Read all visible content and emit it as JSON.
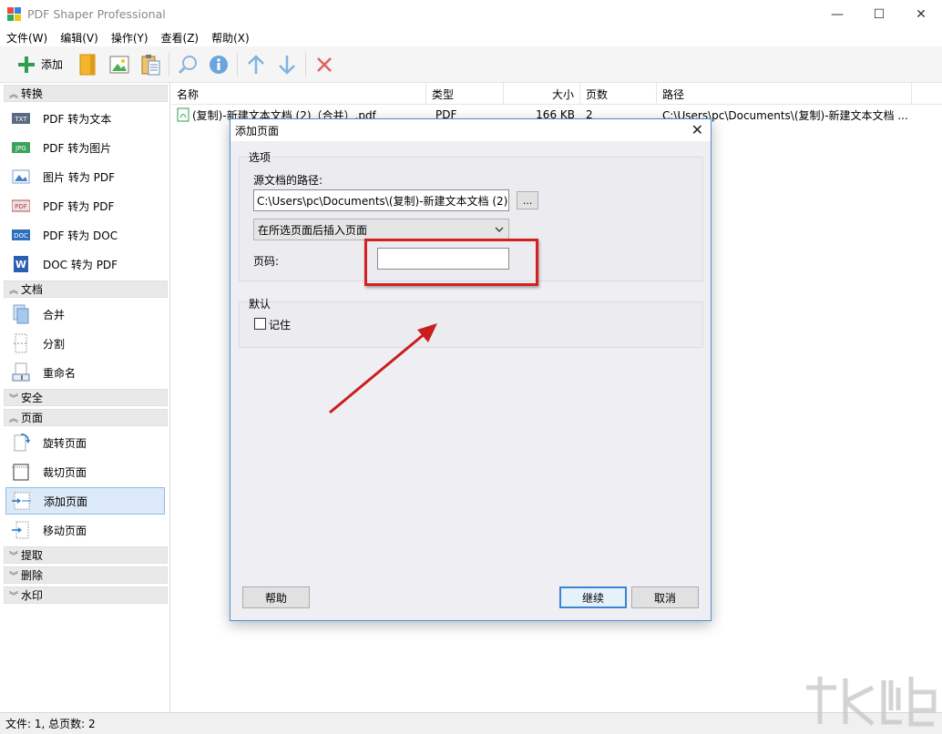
{
  "app": {
    "title": "PDF Shaper Professional"
  },
  "window_controls": {
    "minimize": "—",
    "maximize": "☐",
    "close": "✕"
  },
  "menu": [
    "文件(W)",
    "编辑(V)",
    "操作(Y)",
    "查看(Z)",
    "帮助(X)"
  ],
  "toolbar": {
    "add_label": "添加"
  },
  "sidebar": {
    "groups": {
      "convert": "转换",
      "document": "文档",
      "security": "安全",
      "page": "页面",
      "extract": "提取",
      "delete": "删除",
      "watermark": "水印"
    },
    "convert_items": [
      "PDF 转为文本",
      "PDF 转为图片",
      "图片 转为 PDF",
      "PDF 转为 PDF",
      "PDF 转为 DOC",
      "DOC 转为 PDF"
    ],
    "document_items": [
      "合并",
      "分割",
      "重命名"
    ],
    "page_items": [
      "旋转页面",
      "裁切页面",
      "添加页面",
      "移动页面"
    ],
    "selected_item": "添加页面",
    "icon_badges": {
      "txt": "TXT",
      "jpg": "JPG",
      "pdf": "PDF",
      "doc": "DOC",
      "word": "W"
    }
  },
  "file_list": {
    "columns": [
      "名称",
      "类型",
      "大小",
      "页数",
      "路径"
    ],
    "rows": [
      {
        "name": "(复制)-新建文本文档 (2)（合并）.pdf",
        "type": "PDF",
        "size": "166 KB",
        "pages": "2",
        "path": "C:\\Users\\pc\\Documents\\(复制)-新建文本文档 ..."
      }
    ]
  },
  "status": {
    "text": "文件: 1, 总页数: 2"
  },
  "dialog": {
    "title": "添加页面",
    "options_group": "选项",
    "source_path_label": "源文档的路径:",
    "source_path_value": "C:\\Users\\pc\\Documents\\(复制)-新建文本文档 (2)",
    "browse_label": "...",
    "insert_mode": "在所选页面后插入页面",
    "page_number_label": "页码:",
    "page_number_value": "",
    "default_group": "默认",
    "remember_label": "记住",
    "remember_checked": false,
    "help_button": "帮助",
    "continue_button": "继续",
    "cancel_button": "取消"
  },
  "colors": {
    "accent": "#3b84d2",
    "annotation": "#d42020",
    "selection": "#dbe9f8"
  }
}
